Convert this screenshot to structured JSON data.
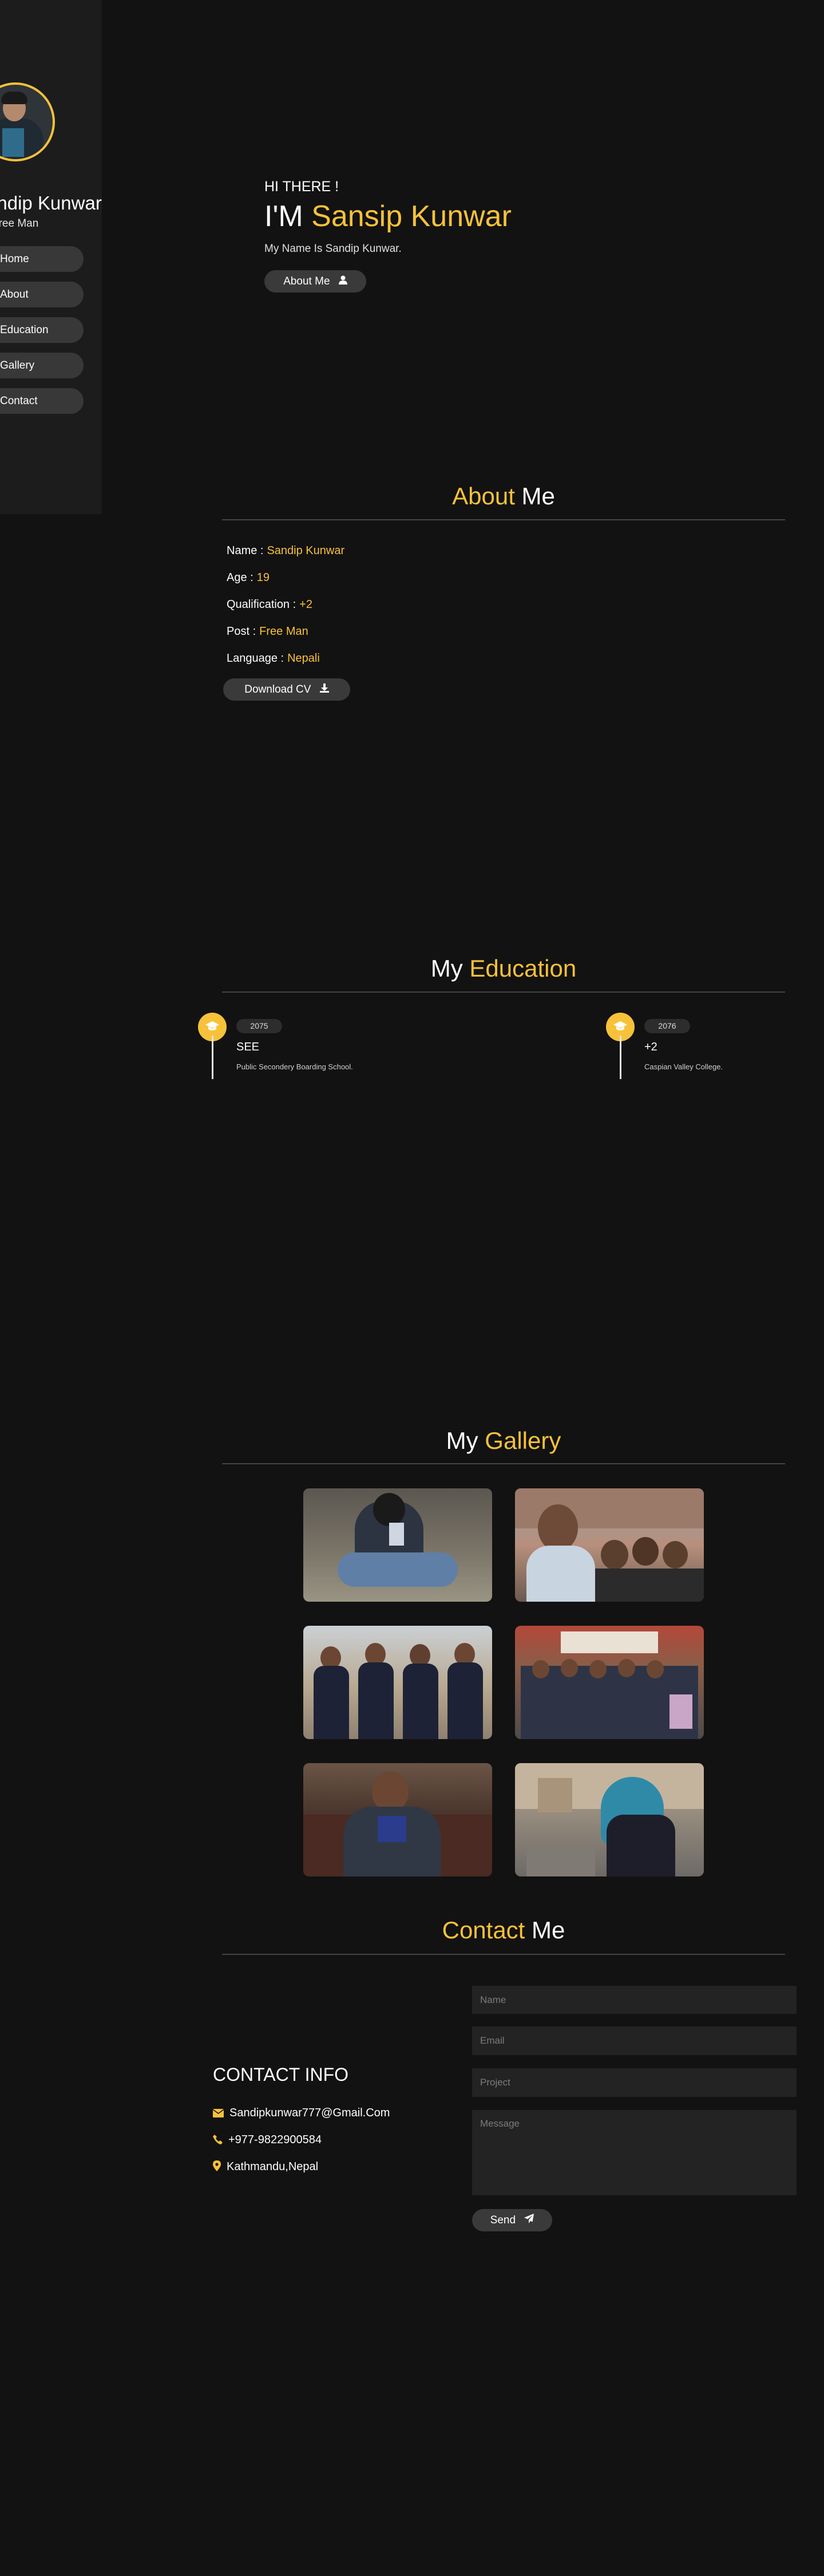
{
  "sidebar": {
    "name": "Sandip Kunwar",
    "role": "Free Man",
    "nav": [
      {
        "label": "Home"
      },
      {
        "label": "About"
      },
      {
        "label": "Education"
      },
      {
        "label": "Gallery"
      },
      {
        "label": "Contact"
      }
    ]
  },
  "hero": {
    "greeting": "HI THERE !",
    "title_prefix": "I'M ",
    "title_name": "Sansip Kunwar",
    "subtitle": "My Name Is Sandip Kunwar.",
    "button_label": "About Me"
  },
  "about": {
    "title_accent": "About",
    "title_rest": " Me",
    "rows": [
      {
        "label": "Name :",
        "value": "Sandip Kunwar"
      },
      {
        "label": "Age :",
        "value": "19"
      },
      {
        "label": "Qualification :",
        "value": "+2"
      },
      {
        "label": "Post :",
        "value": "Free Man"
      },
      {
        "label": "Language :",
        "value": "Nepali"
      }
    ],
    "download_label": "Download CV"
  },
  "education": {
    "title_rest": "My ",
    "title_accent": "Education",
    "items": [
      {
        "year": "2075",
        "name": "SEE",
        "place": "Public Secondery Boarding School."
      },
      {
        "year": "2076",
        "name": "+2",
        "place": "Caspian Valley College."
      }
    ]
  },
  "gallery": {
    "title_rest": "My ",
    "title_accent": "Gallery",
    "photos": [
      {
        "icon": "photo-portrait-sitting"
      },
      {
        "icon": "photo-group-selfie"
      },
      {
        "icon": "photo-four-friends"
      },
      {
        "icon": "photo-college-group"
      },
      {
        "icon": "photo-portrait-sofa"
      },
      {
        "icon": "photo-hooded-portrait"
      }
    ]
  },
  "contact": {
    "title_accent": "Contact",
    "title_rest": " Me",
    "info_title": "CONTACT INFO",
    "email": "Sandipkunwar777@Gmail.Com",
    "phone": "+977-9822900584",
    "location": "Kathmandu,Nepal",
    "form": {
      "name_placeholder": "Name",
      "email_placeholder": "Email",
      "project_placeholder": "Project",
      "message_placeholder": "Message",
      "send_label": "Send"
    }
  },
  "colors": {
    "accent": "#f7c23a",
    "background": "#121212",
    "sidebar": "#1c1c1c",
    "button": "#3a3a3a"
  }
}
